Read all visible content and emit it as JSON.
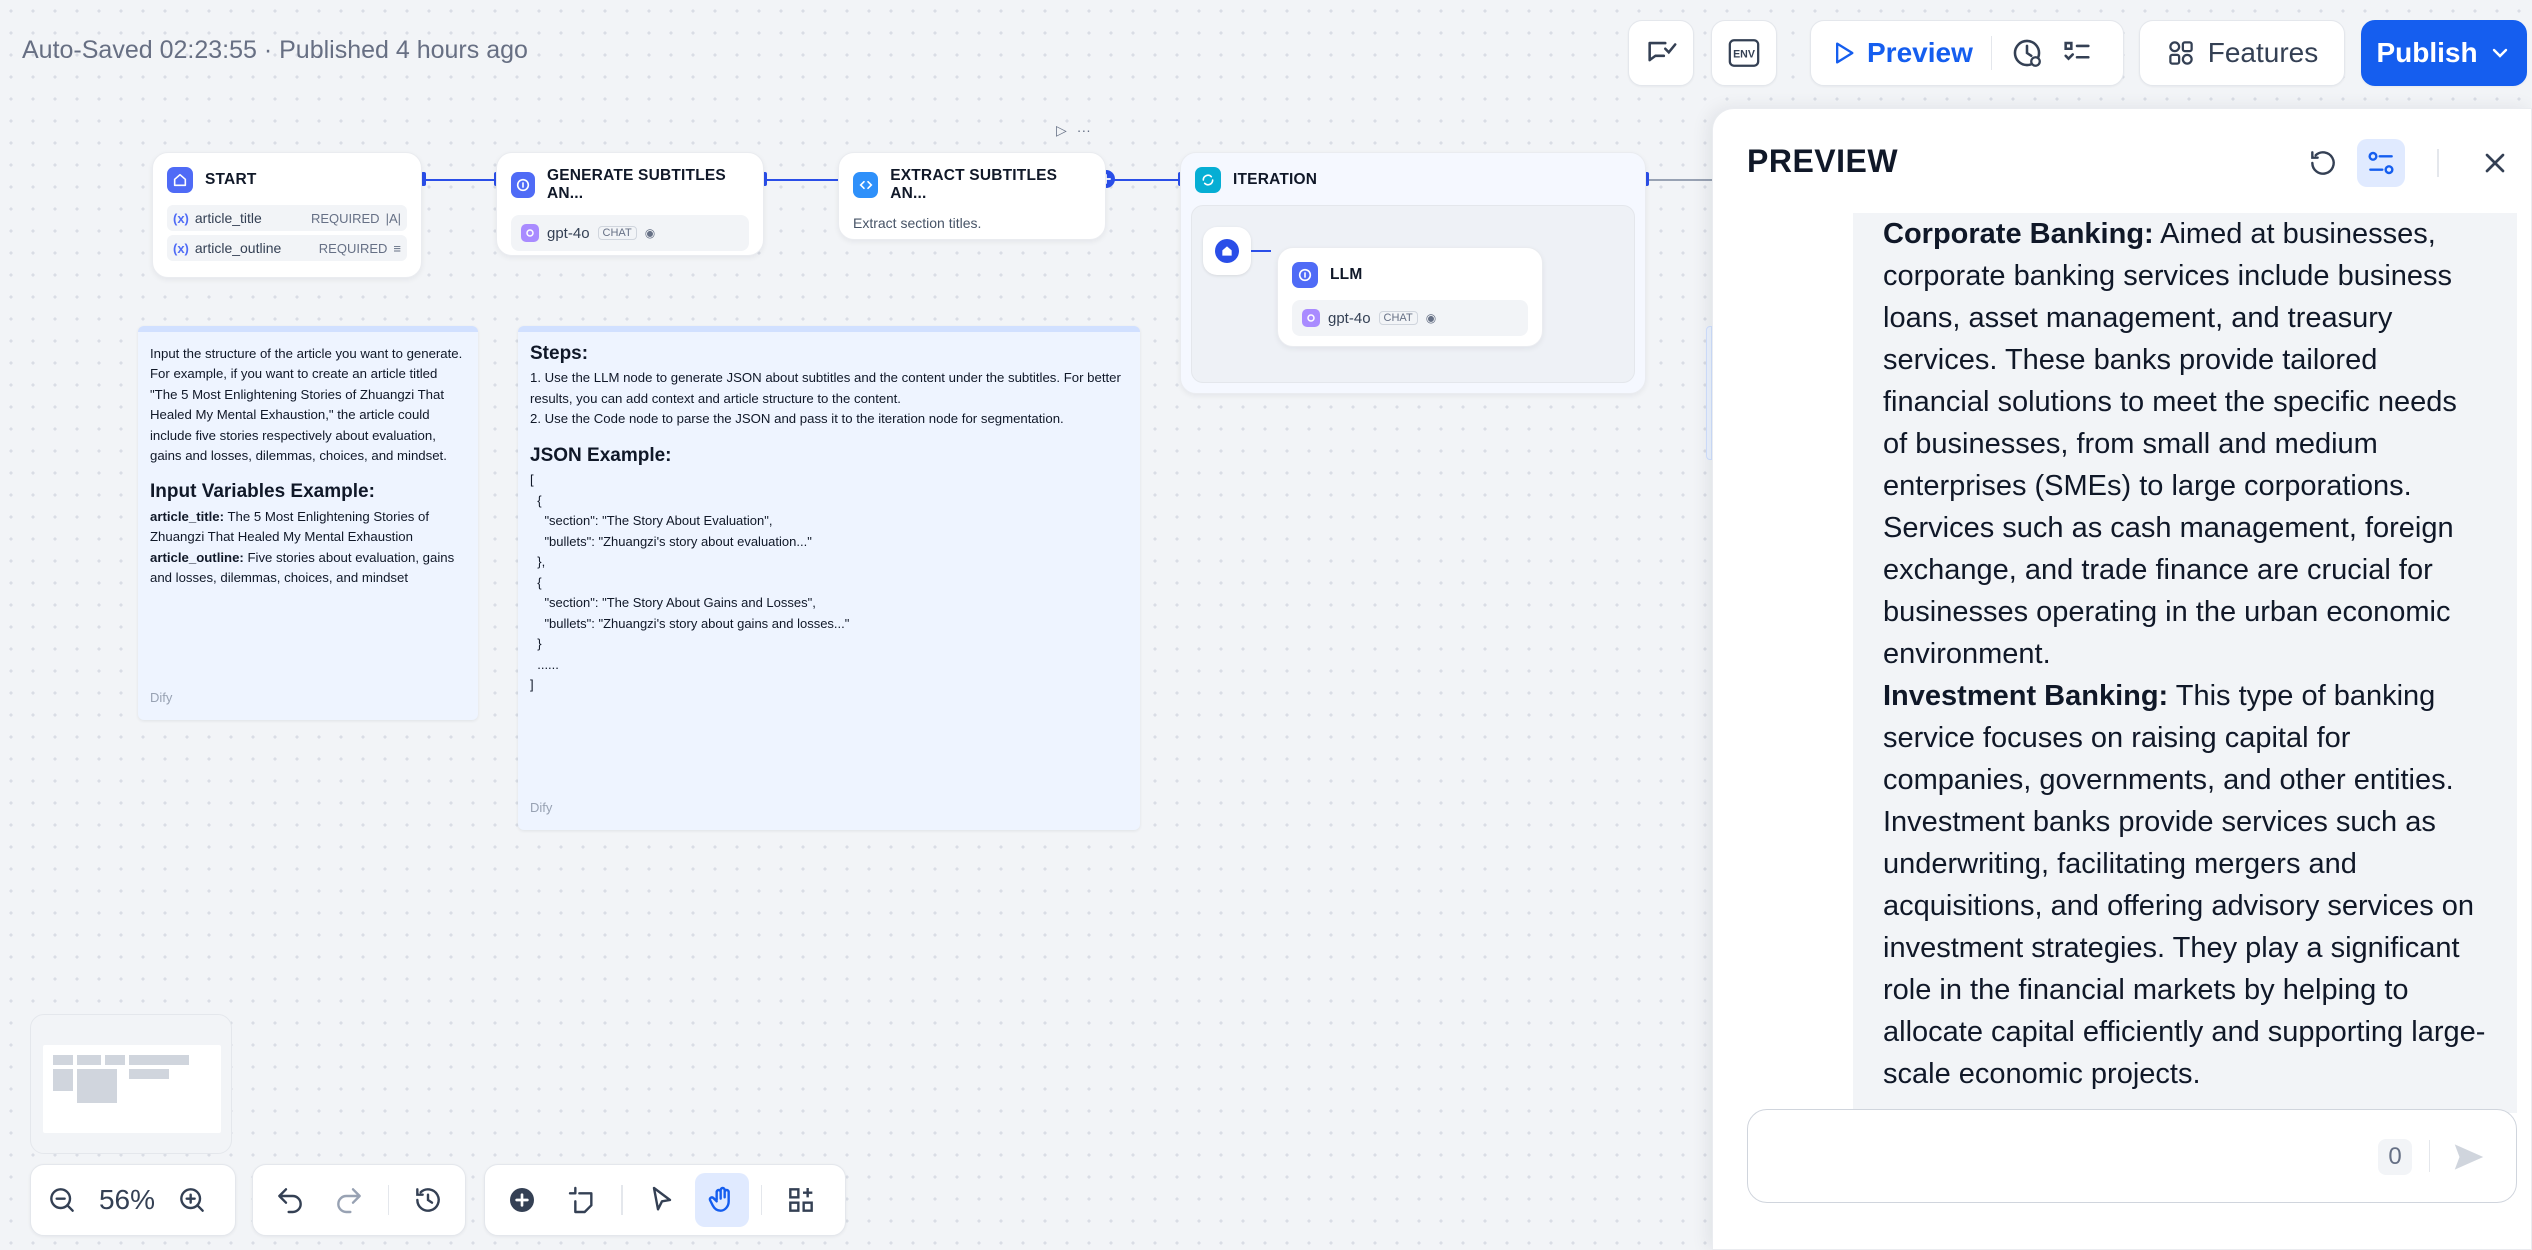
{
  "topbar": {
    "status": "Auto-Saved 02:23:55 · Published 4 hours ago",
    "preview_label": "Preview",
    "features_label": "Features",
    "publish_label": "Publish",
    "env_label": "ENV"
  },
  "nodes": {
    "start": {
      "title": "START",
      "vars": [
        {
          "name": "article_title",
          "req": "REQUIRED"
        },
        {
          "name": "article_outline",
          "req": "REQUIRED"
        }
      ]
    },
    "generate": {
      "title": "GENERATE SUBTITLES AN...",
      "model": "gpt-4o",
      "tag": "CHAT"
    },
    "extract": {
      "title": "EXTRACT SUBTITLES AN...",
      "desc": "Extract section titles."
    },
    "iteration": {
      "title": "ITERATION"
    },
    "llm": {
      "title": "LLM",
      "model": "gpt-4o",
      "tag": "CHAT"
    }
  },
  "notes": {
    "left": {
      "p1": "Input the structure of the article you want to generate. For example, if you want to create an article titled \"The 5 Most Enlightening Stories of Zhuangzi That Healed My Mental Exhaustion,\" the article could include five stories respectively about evaluation, gains and losses, dilemmas, choices, and mindset.",
      "heading": "Input Variables Example:",
      "l1_key": "article_title:",
      "l1_val": " The 5 Most Enlightening Stories of Zhuangzi That Healed My Mental Exhaustion",
      "l2_key": "article_outline:",
      "l2_val": " Five stories about evaluation, gains and losses, dilemmas, choices, and mindset",
      "by": "Dify"
    },
    "right": {
      "heading": "Steps:",
      "s1": "1. Use the LLM node to generate JSON about subtitles and the content under the subtitles. For better results, you can add context and article structure to the content.",
      "s2": "2. Use the Code node to parse the JSON and pass it to the iteration node for segmentation.",
      "json_heading": "JSON Example:",
      "code": "[\n  {\n    \"section\": \"The Story About Evaluation\",\n    \"bullets\": \"Zhuangzi's story about evaluation...\"\n  },\n  {\n    \"section\": \"The Story About Gains and Losses\",\n    \"bullets\": \"Zhuangzi's story about gains and losses...\"\n  }\n  ......\n]",
      "by": "Dify"
    }
  },
  "toolbar": {
    "zoom": "56%"
  },
  "panel": {
    "title": "PREVIEW",
    "p1_bold": "Corporate Banking:",
    "p1_text": " Aimed at businesses, corporate banking services include business loans, asset management, and treasury services. These banks provide tailored financial solutions to meet the specific needs of businesses, from small and medium enterprises (SMEs) to large corporations. Services such as cash management, foreign exchange, and trade finance are crucial for businesses operating in the urban economic environment.",
    "p2_bold": "Investment Banking:",
    "p2_text": " This type of banking service focuses on raising capital for companies, governments, and other entities. Investment banks provide services such as underwriting, facilitating mergers and acquisitions, and offering advisory services on investment strategies. They play a significant role in the financial markets by helping to allocate capital efficiently and supporting large-scale economic projects.",
    "counter": "0",
    "input_value": ""
  }
}
